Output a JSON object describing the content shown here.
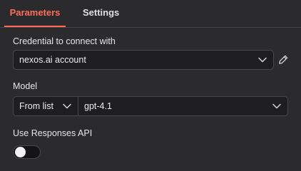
{
  "tabs": {
    "parameters": "Parameters",
    "settings": "Settings"
  },
  "credential": {
    "label": "Credential to connect with",
    "value": "nexos.ai account",
    "edit_icon": "pencil-icon"
  },
  "model": {
    "label": "Model",
    "mode": "From list",
    "value": "gpt-4.1"
  },
  "responses_api": {
    "label": "Use Responses API",
    "enabled": false
  },
  "colors": {
    "background": "#2b2b2e",
    "accent": "#ff6d5a",
    "field_bg": "#1e1e21",
    "border": "#47474c"
  }
}
